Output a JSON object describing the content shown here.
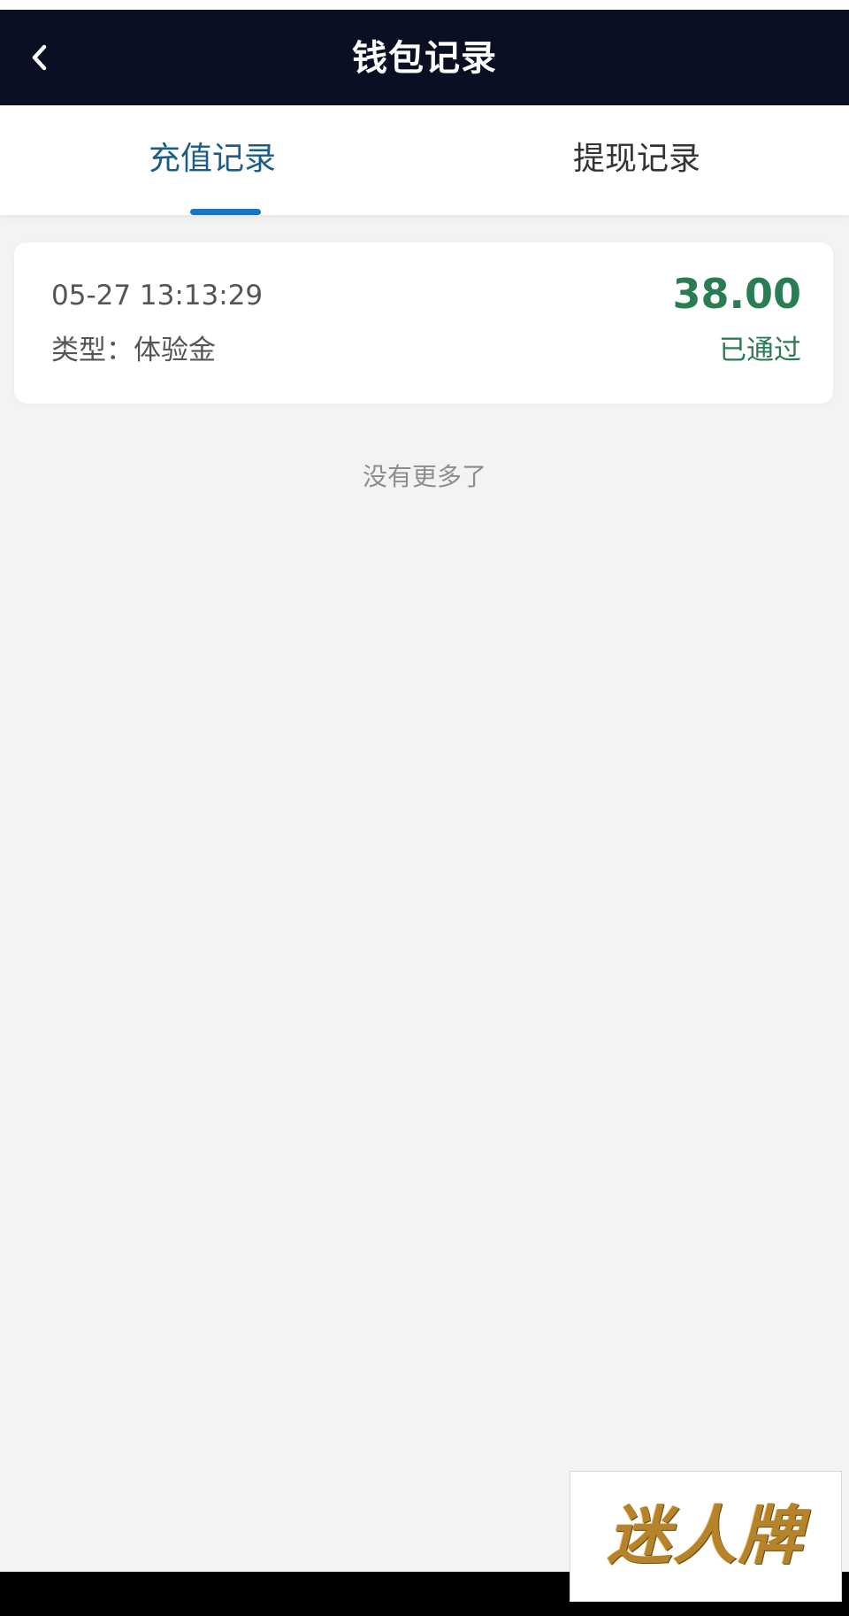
{
  "header": {
    "title": "钱包记录",
    "back_icon": "chevron-left-icon"
  },
  "tabs": [
    {
      "label": "充值记录",
      "active": true
    },
    {
      "label": "提现记录",
      "active": false
    }
  ],
  "records": [
    {
      "time": "05-27 13:13:29",
      "type": "类型：体验金",
      "amount": "38.00",
      "status": "已通过"
    }
  ],
  "list_end_text": "没有更多了",
  "watermark": {
    "text": "迷人牌"
  },
  "colors": {
    "nav_background": "#0b0f24",
    "active_tab": "#1b5d86",
    "tab_indicator": "#1a74c0",
    "amount_green": "#2a7d52",
    "page_background": "#f3f3f2"
  }
}
